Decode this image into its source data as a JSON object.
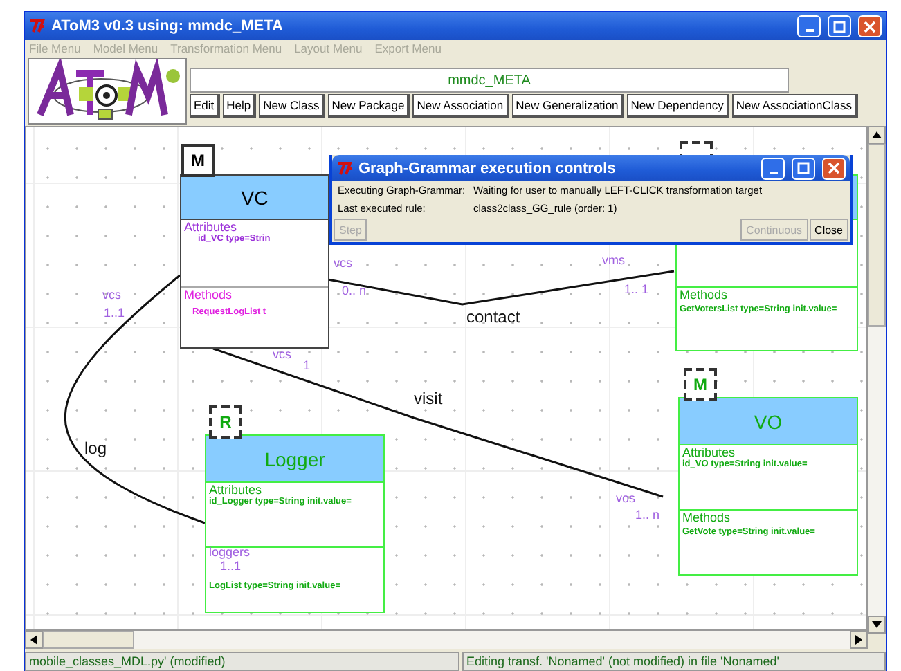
{
  "window": {
    "title": "AToM3 v0.3 using: mmdc_META"
  },
  "menu": [
    "File Menu",
    "Model Menu",
    "Transformation Menu",
    "Layout Menu",
    "Export Menu"
  ],
  "toolbar": {
    "model_name": "mmdc_META",
    "buttons": [
      "Edit",
      "Help",
      "New Class",
      "New Package",
      "New Association",
      "New Generalization",
      "New Dependency",
      "New AssociationClass"
    ]
  },
  "canvas": {
    "classes": [
      {
        "name": "VC",
        "badge": "M",
        "badge_dashed": false,
        "highlighted": true,
        "color": "#9b30d9",
        "attributes_label": "Attributes",
        "attributes": [
          "id_VC type=Strin"
        ],
        "methods_label": "Methods",
        "methods": [
          "RequestLogList t"
        ]
      },
      {
        "badge_dashed": true,
        "highlighted": false,
        "color": "#11aa11",
        "methods_label": "Methods",
        "methods": [
          "GetVotersList type=String init.value="
        ]
      },
      {
        "name": "Logger",
        "badge": "R",
        "badge_dashed": true,
        "highlighted": false,
        "color": "#11aa11",
        "attributes_label": "Attributes",
        "attributes": [
          "id_Logger type=String init.value="
        ],
        "methods": [
          "LogList type=String init.value="
        ]
      },
      {
        "name": "VO",
        "badge": "M",
        "badge_dashed": true,
        "highlighted": false,
        "color": "#11aa11",
        "attributes_label": "Attributes",
        "attributes": [
          "id_VO type=String init.value="
        ],
        "methods_label": "Methods",
        "methods": [
          "GetVote type=String init.value="
        ]
      }
    ],
    "associations": [
      {
        "name": "log"
      },
      {
        "name": "contact"
      },
      {
        "name": "visit"
      }
    ],
    "role_labels": [
      {
        "text": "vcs"
      },
      {
        "text": "0..  n"
      },
      {
        "text": "vms"
      },
      {
        "text": "1..  1"
      },
      {
        "text": "vcs"
      },
      {
        "text": "1"
      },
      {
        "text": "vcs"
      },
      {
        "text": "1..1"
      },
      {
        "text": "vos"
      },
      {
        "text": "1..  n"
      },
      {
        "text": "loggers"
      },
      {
        "text": "1..1"
      }
    ]
  },
  "dialog": {
    "title": "Graph-Grammar execution controls",
    "rows": [
      {
        "label": "Executing Graph-Grammar:",
        "value": "Waiting for user to manually LEFT-CLICK transformation target"
      },
      {
        "label": "Last executed rule:",
        "value": "class2class_GG_rule (order: 1)"
      }
    ],
    "buttons": [
      {
        "label": "Step",
        "disabled": true
      },
      {
        "label": "Continuous",
        "disabled": true
      },
      {
        "label": "Close",
        "disabled": false
      }
    ]
  },
  "status_bar": {
    "left": "mobile_classes_MDL.py' (modified)",
    "right": "Editing transf. 'Nonamed' (not modified) in file 'Nonamed'"
  }
}
